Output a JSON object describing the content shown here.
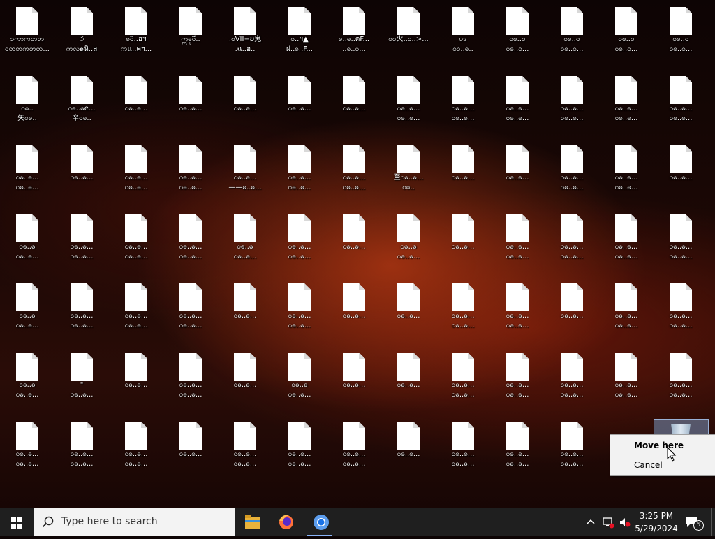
{
  "desktop": {
    "icons": [
      [
        "ခကာကတတ\nဝတတကတတ...",
        "ර\nကလ๑หิ..ล",
        "ဓဝิ..ฮฯ\nကแ..คฯ...",
        "ဣဓုဝี..\n",
        ".ဝVII=ບ鬼\n.ฉ..ฮ..",
        "ဝ..ฯ▲\nฝ..ဓ..F...",
        "ဓ..ဓ..ดF...\n..ဓ..ဝ...",
        "ဝဝ火..ဝ..>...",
        "ပဒ\nဝဝ..ဓ..",
        "ဝဓ..ဝ\nဝဓ..ဝ...",
        "ဝဓ..ဝ\nဝဓ..ဝ...",
        "ဝဓ..ဝ\nဝဓ..ဝ...",
        "ဝဓ..ဝ\nဝဓ..ဝ..."
      ],
      [
        "ဝဓ..\n矢ဝဓ..",
        "ဝဓ..ဓe...\n辛ဝဓ..",
        "ဝဓ..ဓ...",
        "ဝဓ..ဓ...",
        "ဝဓ..ဓ...",
        "ဝဓ..ဓ...",
        "ဝဓ..ဓ...",
        "ဝဓ..ဓ...\nဝဓ..ဓ...",
        "ဝဓ..ဓ...\nဝဓ..ဓ...",
        "ဝဓ..ဓ...\nဝဓ..ဓ...",
        "ဝဓ..ဓ...\nဝဓ..ဓ...",
        "ဝဓ..ဓ...\nဝဓ..ဓ...",
        "ဝဓ..ဓ...\nဝဓ..ဓ..."
      ],
      [
        "ဝဓ..ဓ...\nဝဓ..ဓ...",
        "ဝဓ..ဓ...",
        "ဝဓ..ဓ...\nဝဓ..ဓ...",
        "ဝဓ..ဓ...\nဝဓ..ဓ...",
        "ဝဓ..ဓ...\n——ဓ..ဓ...",
        "ဝဓ..ဓ...\nဝဓ..ဓ...",
        "ဝဓ..ဓ...\nဝဓ..ဓ...",
        "至ဝဓ..ဓ...\nဝဓ..",
        "ဝဓ..ဓ...",
        "ဝဓ..ဓ...",
        "ဝဓ..ဓ...\nဝဓ..ဓ...",
        "ဝဓ..ဓ...\nဝဓ..ဓ...",
        "ဝဓ..ဓ..."
      ],
      [
        "ဝဓ..ဓ\nဝဓ..ဓ...",
        "ဝဓ..ဓ...\nဝဓ..ဓ...",
        "ဝဓ..ဓ...\nဝဓ..ဓ...",
        "ဝဓ..ဓ...\nဝဓ..ဓ...",
        "ဝဓ..ဓ\nဝဓ..ဓ...",
        "ဝဓ..ဓ...\nဝဓ..ဓ...",
        "ဝဓ..ဓ...",
        "ဝဓ..ဓ\nဝဓ..ဓ...",
        "ဝဓ..ဓ...",
        "ဝဓ..ဓ...\nဝဓ..ဓ...",
        "ဝဓ..ဓ...\nဝဓ..ဓ...",
        "ဝဓ..ဓ...\nဝဓ..ဓ...",
        "ဝဓ..ဓ...\nဝဓ..ဓ..."
      ],
      [
        "ဝဓ..ဓ\nဝဓ..ဓ...",
        "ဝဓ..ဓ...\nဝဓ..ဓ...",
        "ဝဓ..ဓ...\nဝဓ..ဓ...",
        "ဝဓ..ဓ...\nဝဓ..ဓ...",
        "ဝဓ..ဓ...",
        "ဝဓ..ဓ...\nဝဓ..ဓ...",
        "ဝဓ..ဓ...",
        "ဝဓ..ဓ...",
        "ဝဓ..ဓ...\nဝဓ..ဓ...",
        "ဝဓ..ဓ...\nဝဓ..ဓ...",
        "ဝဓ..ဓ...",
        "ဝဓ..ဓ...\nဝဓ..ဓ...",
        "ဝဓ..ဓ...\nဝဓ..ဓ..."
      ],
      [
        "ဝဓ..ဓ\nဝဓ..ဓ...",
        "\"\nဝဓ..ဓ...",
        "ဝဓ..ဓ...",
        "ဝဓ..ဓ...\nဝဓ..ဓ...",
        "ဝဓ..ဓ...",
        "ဝဓ..ဓ\nဝဓ..ဓ...",
        "ဝဓ..ဓ...",
        "ဝဓ..ဓ...",
        "ဝဓ..ဓ...\nဝဓ..ဓ...",
        "ဝဓ..ဓ...\nဝဓ..ဓ...",
        "ဝဓ..ဓ...\nဝဓ..ဓ...",
        "ဝဓ..ဓ...\nဝဓ..ဓ...",
        "ဝဓ..ဓ...\nဝဓ..ဓ..."
      ],
      [
        "ဝဓ..ဓ...\nဝဓ..ဓ...",
        "ဝဓ..ဓ...\nဝဓ..ဓ...",
        "ဝဓ..ဓ...\nဝဓ..ဓ...",
        "ဝဓ..ဓ...",
        "ဝဓ..ဓ...\nဝဓ..ဓ...",
        "ဝဓ..ဓ...\nဝဓ..ဓ...",
        "ဝဓ..ဓ...\nဝဓ..ဓ...",
        "ဝဓ..ဓ...",
        "ဝဓ..ဓ...\nဝဓ..ဓ...",
        "ဝဓ..ဓ...\nဝဓ..ဓ...",
        "ဝဓ..ဓ...\nဝဓ..ဓ..."
      ]
    ]
  },
  "recycle_bin": {
    "icon": "recycle-bin-icon"
  },
  "context_menu": {
    "items": [
      {
        "label": "Move here",
        "default": true
      },
      {
        "label": "Cancel",
        "default": false
      }
    ]
  },
  "taskbar": {
    "search_placeholder": "Type here to search",
    "pinned": [
      "file-explorer-icon",
      "firefox-icon",
      "chromium-icon"
    ],
    "clock": {
      "time": "3:25 PM",
      "date": "5/29/2024"
    },
    "notification_count": "5"
  }
}
